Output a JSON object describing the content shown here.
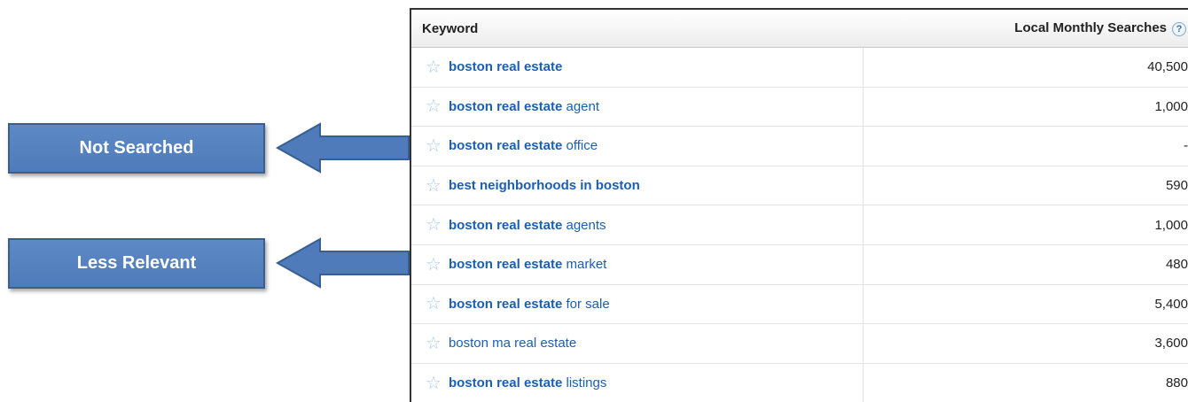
{
  "callouts": {
    "not_searched": "Not Searched",
    "less_relevant": "Less Relevant"
  },
  "table": {
    "headers": {
      "keyword": "Keyword",
      "searches": "Local Monthly Searches",
      "help_icon": "?"
    },
    "rows": [
      {
        "bold": "boston real estate",
        "rest": "",
        "value": "40,500"
      },
      {
        "bold": "boston real estate",
        "rest": " agent",
        "value": "1,000"
      },
      {
        "bold": "boston real estate",
        "rest": " office",
        "value": "-"
      },
      {
        "bold": "best neighborhoods in boston",
        "rest": "",
        "value": "590"
      },
      {
        "bold": "boston real estate",
        "rest": " agents",
        "value": "1,000"
      },
      {
        "bold": "boston real estate",
        "rest": " market",
        "value": "480"
      },
      {
        "bold": "boston real estate",
        "rest": " for sale",
        "value": "5,400"
      },
      {
        "bold": "",
        "rest": "boston ma real estate",
        "value": "3,600"
      },
      {
        "bold": "boston real estate",
        "rest": " listings",
        "value": "880"
      }
    ]
  },
  "colors": {
    "callout_fill": "#4f7bba",
    "link": "#1a5fb4",
    "star": "#a9c8e8"
  },
  "icons": {
    "star": "star-icon",
    "arrow": "left-arrow-icon",
    "help": "help-icon"
  }
}
